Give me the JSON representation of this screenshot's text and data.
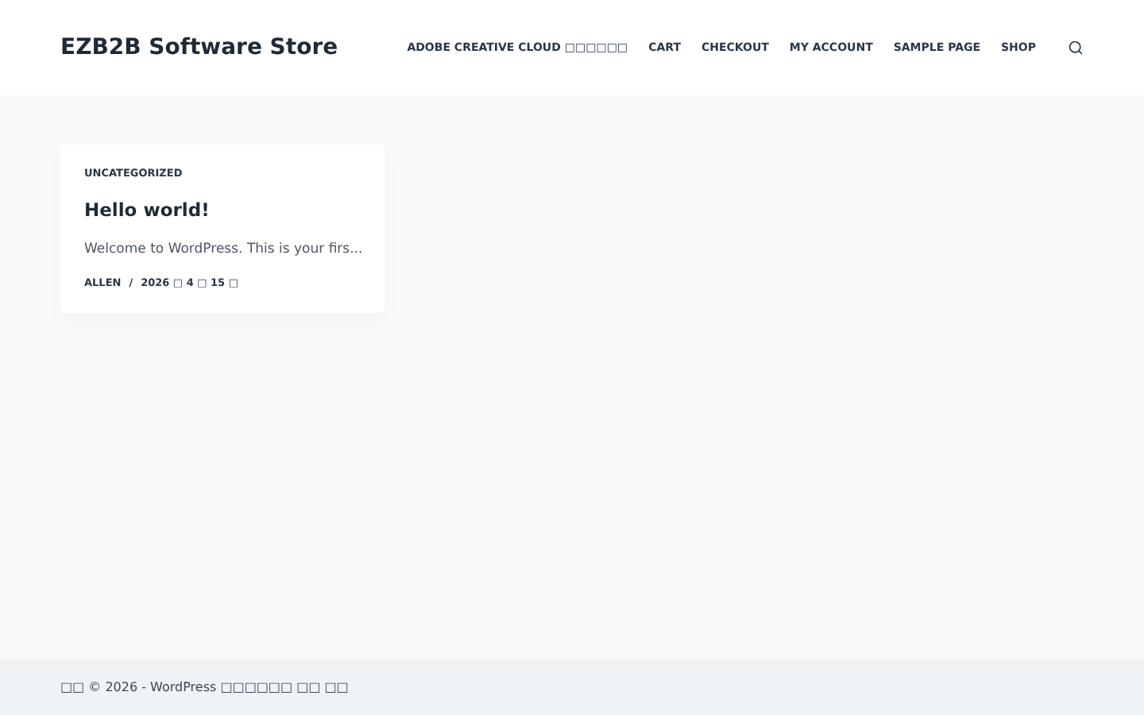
{
  "header": {
    "site_title": "EZB2B Software Store",
    "nav": [
      {
        "label": "ADOBE CREATIVE CLOUD □□□□□□"
      },
      {
        "label": "CART"
      },
      {
        "label": "CHECKOUT"
      },
      {
        "label": "MY ACCOUNT"
      },
      {
        "label": "SAMPLE PAGE"
      },
      {
        "label": "SHOP"
      }
    ]
  },
  "posts": [
    {
      "category": "UNCATEGORIZED",
      "title": "Hello world!",
      "excerpt": "Welcome to WordPress. This is your firs...",
      "author": "ALLEN",
      "separator": "/",
      "date": "2026 □ 4 □ 15 □"
    }
  ],
  "footer": {
    "text": "□□ © 2026 - WordPress □□□□□□ □□ □□"
  }
}
